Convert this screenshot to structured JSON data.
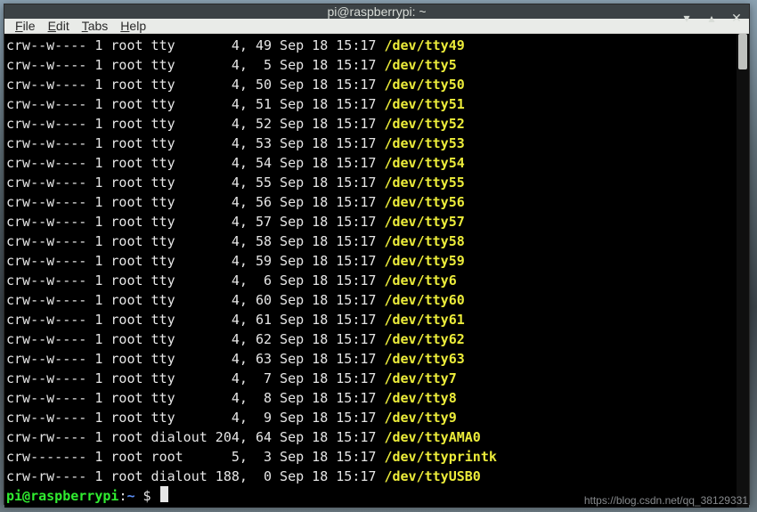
{
  "window": {
    "title": "pi@raspberrypi: ~"
  },
  "menubar": {
    "items": [
      {
        "accel": "F",
        "rest": "ile"
      },
      {
        "accel": "E",
        "rest": "dit"
      },
      {
        "accel": "T",
        "rest": "abs"
      },
      {
        "accel": "H",
        "rest": "elp"
      }
    ]
  },
  "colors": {
    "accent_yellow": "#ecec3a",
    "prompt_green": "#30ec30",
    "prompt_blue": "#5a8ef5"
  },
  "terminal": {
    "rows": [
      {
        "perm": "crw--w----",
        "links": "1",
        "user": "root",
        "group": "tty",
        "maj": "4",
        "min": "49",
        "date": "Sep 18",
        "time": "15:17",
        "dev": "/dev/tty49"
      },
      {
        "perm": "crw--w----",
        "links": "1",
        "user": "root",
        "group": "tty",
        "maj": "4",
        "min": "5",
        "date": "Sep 18",
        "time": "15:17",
        "dev": "/dev/tty5"
      },
      {
        "perm": "crw--w----",
        "links": "1",
        "user": "root",
        "group": "tty",
        "maj": "4",
        "min": "50",
        "date": "Sep 18",
        "time": "15:17",
        "dev": "/dev/tty50"
      },
      {
        "perm": "crw--w----",
        "links": "1",
        "user": "root",
        "group": "tty",
        "maj": "4",
        "min": "51",
        "date": "Sep 18",
        "time": "15:17",
        "dev": "/dev/tty51"
      },
      {
        "perm": "crw--w----",
        "links": "1",
        "user": "root",
        "group": "tty",
        "maj": "4",
        "min": "52",
        "date": "Sep 18",
        "time": "15:17",
        "dev": "/dev/tty52"
      },
      {
        "perm": "crw--w----",
        "links": "1",
        "user": "root",
        "group": "tty",
        "maj": "4",
        "min": "53",
        "date": "Sep 18",
        "time": "15:17",
        "dev": "/dev/tty53"
      },
      {
        "perm": "crw--w----",
        "links": "1",
        "user": "root",
        "group": "tty",
        "maj": "4",
        "min": "54",
        "date": "Sep 18",
        "time": "15:17",
        "dev": "/dev/tty54"
      },
      {
        "perm": "crw--w----",
        "links": "1",
        "user": "root",
        "group": "tty",
        "maj": "4",
        "min": "55",
        "date": "Sep 18",
        "time": "15:17",
        "dev": "/dev/tty55"
      },
      {
        "perm": "crw--w----",
        "links": "1",
        "user": "root",
        "group": "tty",
        "maj": "4",
        "min": "56",
        "date": "Sep 18",
        "time": "15:17",
        "dev": "/dev/tty56"
      },
      {
        "perm": "crw--w----",
        "links": "1",
        "user": "root",
        "group": "tty",
        "maj": "4",
        "min": "57",
        "date": "Sep 18",
        "time": "15:17",
        "dev": "/dev/tty57"
      },
      {
        "perm": "crw--w----",
        "links": "1",
        "user": "root",
        "group": "tty",
        "maj": "4",
        "min": "58",
        "date": "Sep 18",
        "time": "15:17",
        "dev": "/dev/tty58"
      },
      {
        "perm": "crw--w----",
        "links": "1",
        "user": "root",
        "group": "tty",
        "maj": "4",
        "min": "59",
        "date": "Sep 18",
        "time": "15:17",
        "dev": "/dev/tty59"
      },
      {
        "perm": "crw--w----",
        "links": "1",
        "user": "root",
        "group": "tty",
        "maj": "4",
        "min": "6",
        "date": "Sep 18",
        "time": "15:17",
        "dev": "/dev/tty6"
      },
      {
        "perm": "crw--w----",
        "links": "1",
        "user": "root",
        "group": "tty",
        "maj": "4",
        "min": "60",
        "date": "Sep 18",
        "time": "15:17",
        "dev": "/dev/tty60"
      },
      {
        "perm": "crw--w----",
        "links": "1",
        "user": "root",
        "group": "tty",
        "maj": "4",
        "min": "61",
        "date": "Sep 18",
        "time": "15:17",
        "dev": "/dev/tty61"
      },
      {
        "perm": "crw--w----",
        "links": "1",
        "user": "root",
        "group": "tty",
        "maj": "4",
        "min": "62",
        "date": "Sep 18",
        "time": "15:17",
        "dev": "/dev/tty62"
      },
      {
        "perm": "crw--w----",
        "links": "1",
        "user": "root",
        "group": "tty",
        "maj": "4",
        "min": "63",
        "date": "Sep 18",
        "time": "15:17",
        "dev": "/dev/tty63"
      },
      {
        "perm": "crw--w----",
        "links": "1",
        "user": "root",
        "group": "tty",
        "maj": "4",
        "min": "7",
        "date": "Sep 18",
        "time": "15:17",
        "dev": "/dev/tty7"
      },
      {
        "perm": "crw--w----",
        "links": "1",
        "user": "root",
        "group": "tty",
        "maj": "4",
        "min": "8",
        "date": "Sep 18",
        "time": "15:17",
        "dev": "/dev/tty8"
      },
      {
        "perm": "crw--w----",
        "links": "1",
        "user": "root",
        "group": "tty",
        "maj": "4",
        "min": "9",
        "date": "Sep 18",
        "time": "15:17",
        "dev": "/dev/tty9"
      },
      {
        "perm": "crw-rw----",
        "links": "1",
        "user": "root",
        "group": "dialout",
        "maj": "204",
        "min": "64",
        "date": "Sep 18",
        "time": "15:17",
        "dev": "/dev/ttyAMA0"
      },
      {
        "perm": "crw-------",
        "links": "1",
        "user": "root",
        "group": "root",
        "maj": "5",
        "min": "3",
        "date": "Sep 18",
        "time": "15:17",
        "dev": "/dev/ttyprintk"
      },
      {
        "perm": "crw-rw----",
        "links": "1",
        "user": "root",
        "group": "dialout",
        "maj": "188",
        "min": "0",
        "date": "Sep 18",
        "time": "15:17",
        "dev": "/dev/ttyUSB0"
      }
    ],
    "prompt": {
      "userhost": "pi@raspberrypi",
      "sep": ":",
      "cwd": "~",
      "symbol": " $ "
    }
  },
  "watermark": "https://blog.csdn.net/qq_38129331"
}
